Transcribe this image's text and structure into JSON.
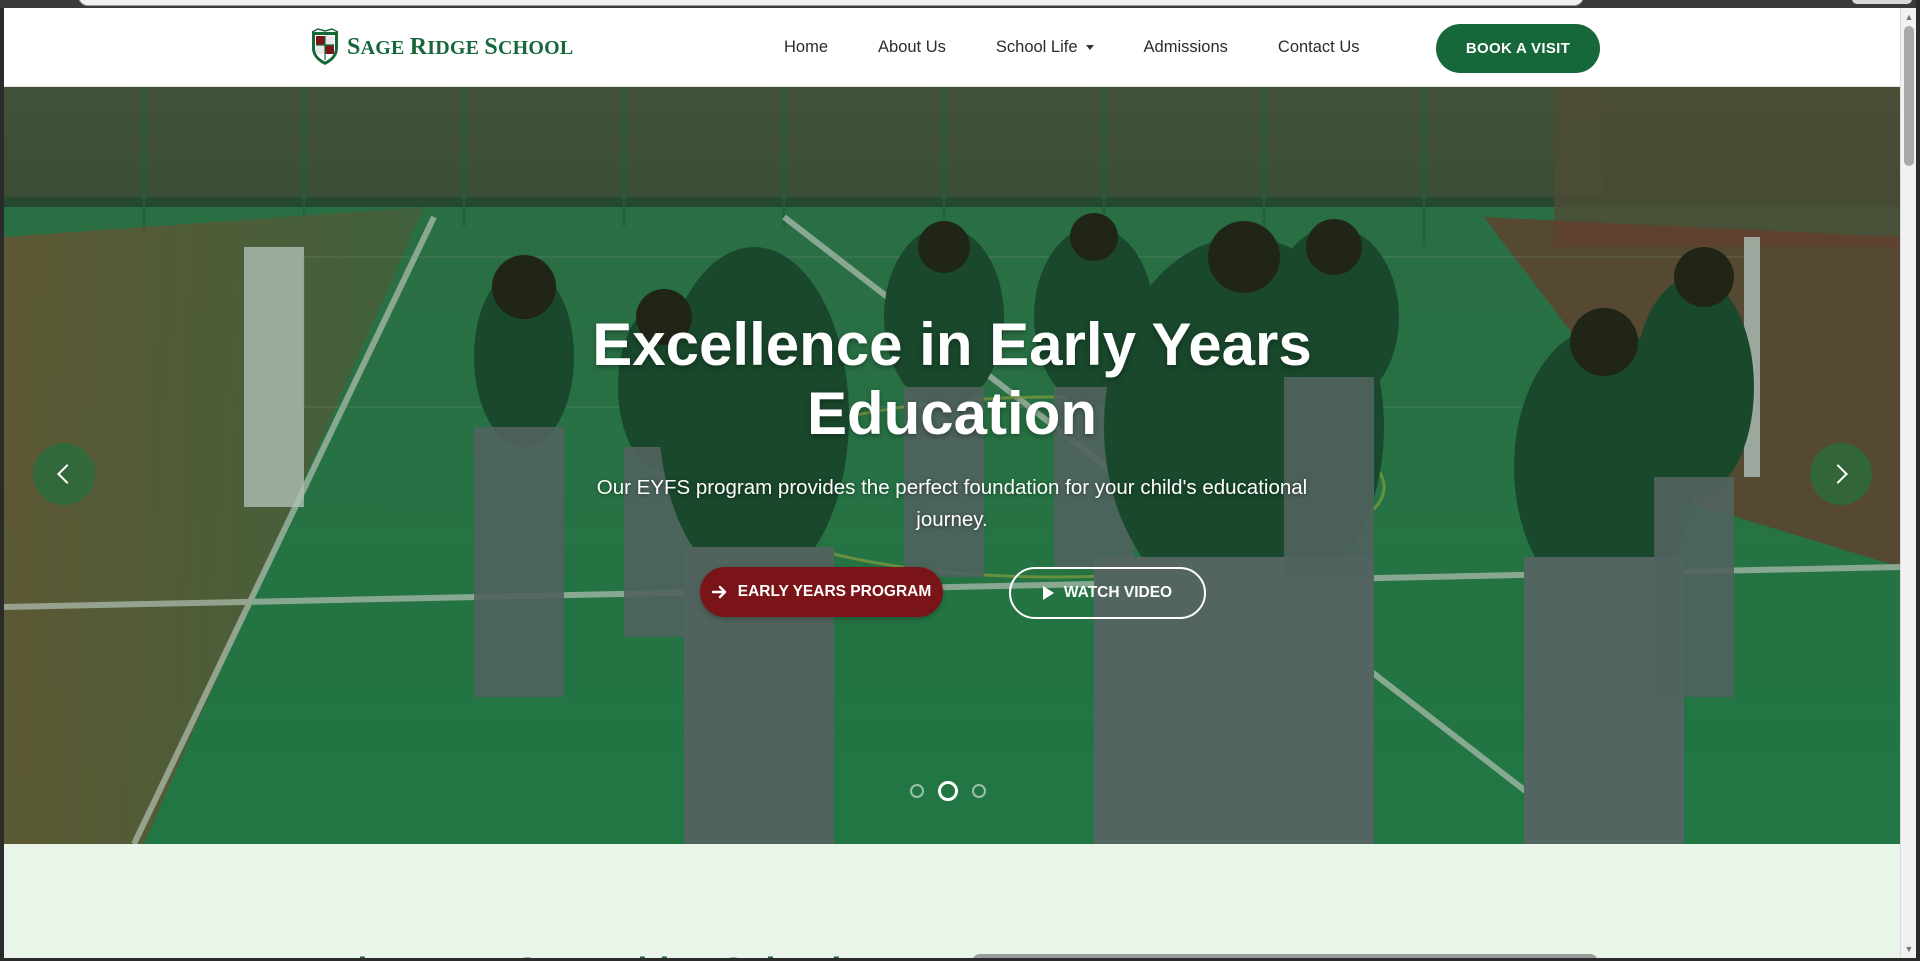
{
  "brand": {
    "name_big1": "S",
    "name_small1": "AGE ",
    "name_big2": "R",
    "name_small2": "IDGE ",
    "name_big3": "S",
    "name_small3": "CHOOL",
    "primary_color": "#16673a",
    "accent_color": "#7b1418"
  },
  "nav": {
    "items": [
      {
        "label": "Home"
      },
      {
        "label": "About Us"
      },
      {
        "label": "School Life",
        "dropdown": true
      },
      {
        "label": "Admissions"
      },
      {
        "label": "Contact Us"
      }
    ],
    "cta_label": "BOOK A VISIT"
  },
  "hero": {
    "title_line1": "Excellence in Early Years",
    "title_line2": "Education",
    "subtitle_line1": "Our EYFS program provides the perfect foundation for your child's educational",
    "subtitle_line2": "journey.",
    "primary_button": "EARLY YEARS PROGRAM",
    "primary_icon": "arrow-right-icon",
    "secondary_button": "WATCH VIDEO",
    "secondary_icon": "play-icon",
    "slide_count": 3,
    "active_slide": 2
  },
  "welcome": {
    "title": "Welcome to Sage Ridge School"
  }
}
